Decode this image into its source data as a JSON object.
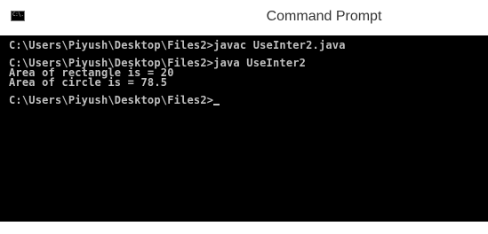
{
  "window": {
    "title": "Command Prompt"
  },
  "icons": {
    "app_icon": "command-prompt-icon",
    "app_icon_glyph": "C:\\."
  },
  "console": {
    "lines": [
      "C:\\Users\\Piyush\\Desktop\\Files2>javac UseInter2.java",
      "",
      "C:\\Users\\Piyush\\Desktop\\Files2>java UseInter2",
      "Area of rectangle is = 20",
      "Area of circle is = 78.5",
      "",
      "C:\\Users\\Piyush\\Desktop\\Files2>"
    ]
  },
  "colors": {
    "console_background": "#000000",
    "console_text": "#c0c0c0",
    "titlebar_background": "#ffffff",
    "title_text": "#333333"
  }
}
